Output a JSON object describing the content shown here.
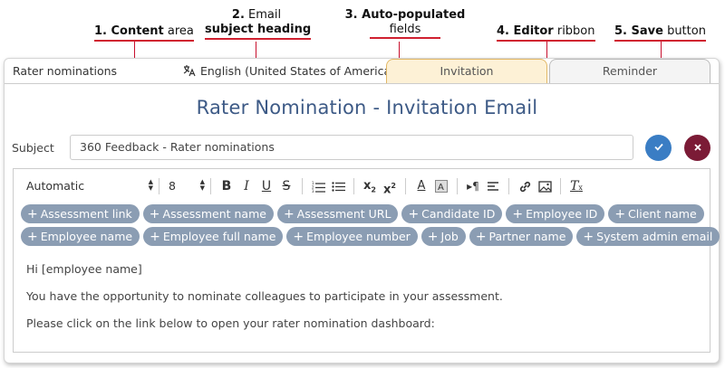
{
  "callouts": {
    "c1_bold": "1. Content",
    "c1_rest": " area",
    "c2_line1": "2. Email",
    "c2_line2": "subject heading",
    "c3_line1": "3. Auto-populated",
    "c3_line2": "fields",
    "c4_bold": "4. Editor",
    "c4_rest": " ribbon",
    "c5_bold": "5. Save",
    "c5_rest": " button"
  },
  "header": {
    "section_label": "Rater nominations",
    "language": "English (United States of America)",
    "language_icon": "translate-icon"
  },
  "tabs": [
    {
      "label": "Invitation",
      "active": true
    },
    {
      "label": "Reminder",
      "active": false
    }
  ],
  "email": {
    "title": "Rater Nomination - Invitation Email",
    "subject_label": "Subject",
    "subject_value": "360 Feedback - Rater nominations"
  },
  "actions": {
    "save_icon": "check-icon",
    "cancel_icon": "close-icon",
    "save_color": "#3a7dc4",
    "cancel_color": "#7b1b36"
  },
  "toolbar": {
    "font_color_select": "Automatic",
    "font_size_select": "8",
    "buttons": [
      "bold-icon",
      "italic-icon",
      "underline-icon",
      "strikethrough-icon",
      "ordered-list-icon",
      "bullet-list-icon",
      "subscript-icon",
      "superscript-icon",
      "text-color-icon",
      "background-color-icon",
      "text-direction-icon",
      "align-icon",
      "link-icon",
      "image-icon",
      "clear-format-icon"
    ]
  },
  "fields_row1": [
    "Assessment link",
    "Assessment name",
    "Assessment URL",
    "Candidate ID",
    "Employee ID",
    "Client name"
  ],
  "fields_row2": [
    "Employee name",
    "Employee full name",
    "Employee number",
    "Job",
    "Partner name",
    "System admin email"
  ],
  "content": {
    "line1": "Hi [employee name]",
    "line2": "You have the opportunity to nominate colleagues to participate in your assessment.",
    "line3": "Please click on the link below to open your rater nomination dashboard:"
  },
  "colors": {
    "chip_bg": "#8b9db3",
    "title_color": "#3d5a86",
    "callout_line": "#c8102e",
    "invitation_tab_bg": "#fdf1d6"
  }
}
